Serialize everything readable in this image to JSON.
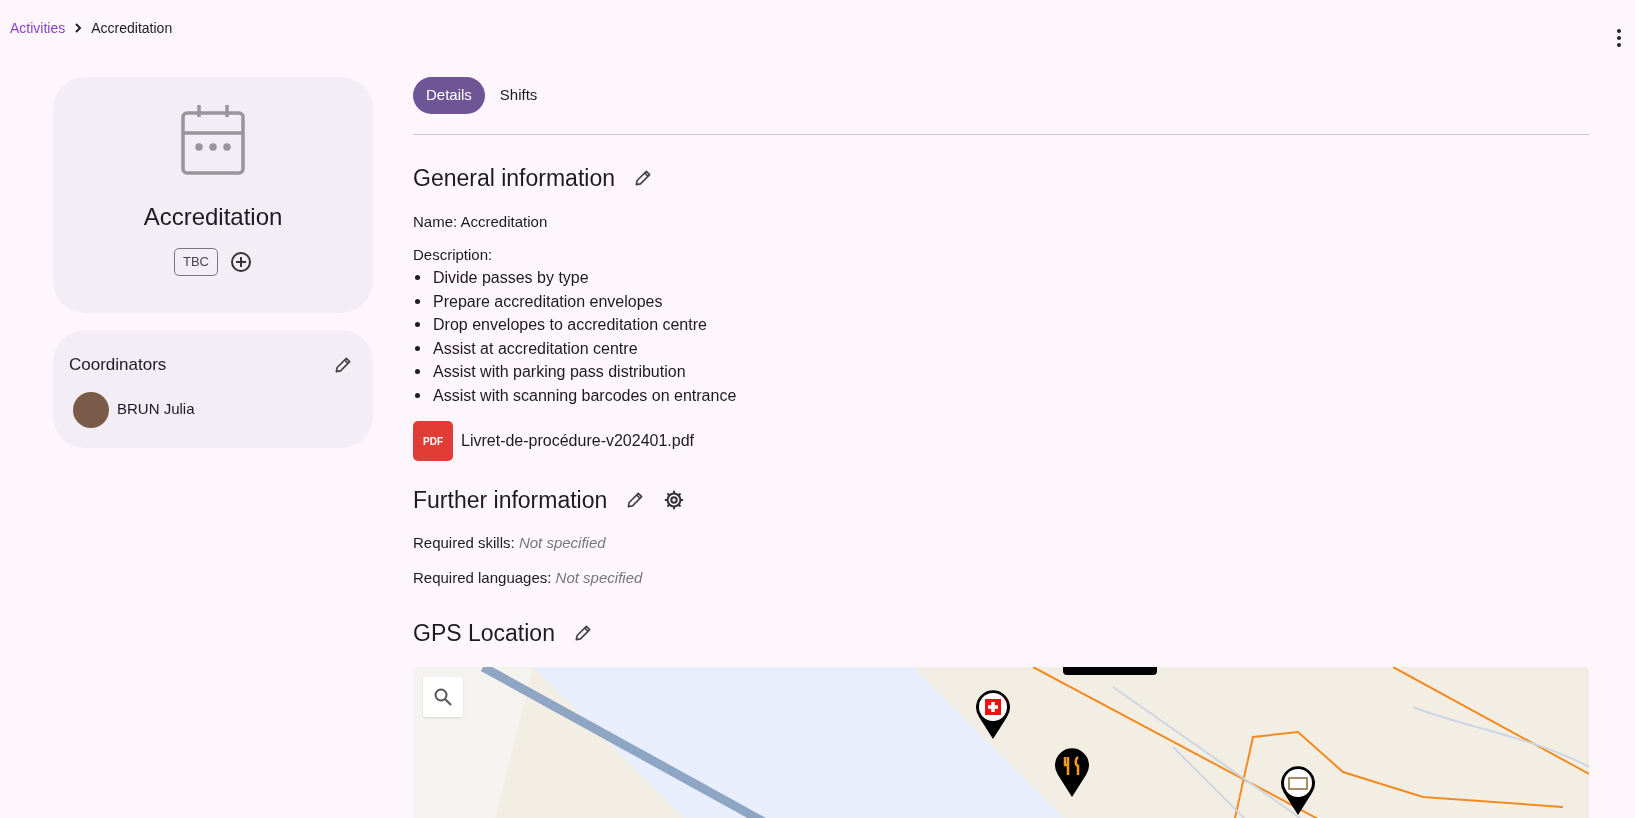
{
  "breadcrumb": [
    {
      "label": "Activities",
      "kind": "link"
    },
    {
      "label": "Accreditation",
      "kind": "current"
    }
  ],
  "activity_card": {
    "title": "Accreditation",
    "tag": "TBC"
  },
  "coordinators": {
    "title": "Coordinators",
    "people": [
      {
        "name": "BRUN Julia"
      }
    ]
  },
  "tabs": [
    {
      "label": "Details",
      "selected": true
    },
    {
      "label": "Shifts",
      "selected": false
    }
  ],
  "general_information": {
    "title": "General information",
    "name_label": "Name:",
    "name_value": "Accreditation",
    "description_label": "Description:",
    "items": [
      "Divide passes by type",
      "Prepare accreditation envelopes",
      "Drop envelopes to accreditation centre",
      "Assist at accreditation centre",
      "Assist with parking pass distribution",
      "Assist with scanning barcodes on entrance"
    ],
    "attachment": {
      "badge": "PDF",
      "filename": "Livret-de-procédure-v202401.pdf"
    }
  },
  "further_information": {
    "title": "Further information",
    "fields": [
      {
        "label": "Required skills:",
        "value": "Not specified"
      },
      {
        "label": "Required languages:",
        "value": "Not specified"
      }
    ]
  },
  "gps_location": {
    "title": "GPS Location"
  }
}
